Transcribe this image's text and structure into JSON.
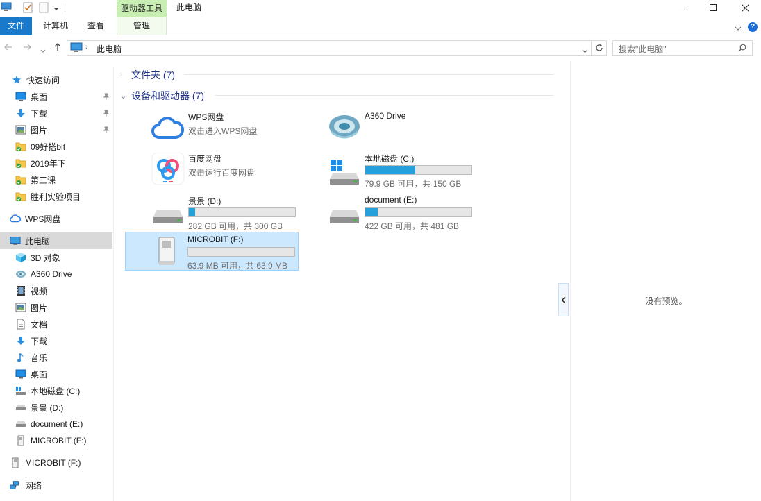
{
  "titlebar": {
    "context_tab_group": "驱动器工具",
    "window_title": "此电脑"
  },
  "ribbon": {
    "tabs": [
      {
        "label": "文件",
        "active": true
      },
      {
        "label": "计算机"
      },
      {
        "label": "查看"
      },
      {
        "label": "管理"
      }
    ],
    "help_label": "?"
  },
  "address": {
    "path_label": "此电脑"
  },
  "search": {
    "placeholder": "搜索\"此电脑\""
  },
  "sidebar": {
    "items": [
      {
        "label": "快速访问",
        "icon": "star-icon"
      },
      {
        "label": "桌面",
        "icon": "desktop-icon",
        "pinned": true
      },
      {
        "label": "下载",
        "icon": "download-icon",
        "pinned": true
      },
      {
        "label": "图片",
        "icon": "pictures-icon",
        "pinned": true
      },
      {
        "label": "09好搭bit",
        "icon": "folder-sync-icon"
      },
      {
        "label": "2019年下",
        "icon": "folder-sync-icon"
      },
      {
        "label": "第三课",
        "icon": "folder-sync-icon"
      },
      {
        "label": "胜利实验项目",
        "icon": "folder-sync-icon"
      },
      {
        "label": "WPS网盘",
        "icon": "cloud-icon"
      },
      {
        "label": "此电脑",
        "icon": "computer-icon",
        "selected": true
      },
      {
        "label": "3D 对象",
        "icon": "3d-objects-icon"
      },
      {
        "label": "A360 Drive",
        "icon": "a360-icon"
      },
      {
        "label": "视频",
        "icon": "video-icon"
      },
      {
        "label": "图片",
        "icon": "pictures-icon"
      },
      {
        "label": "文档",
        "icon": "documents-icon"
      },
      {
        "label": "下载",
        "icon": "download-icon"
      },
      {
        "label": "音乐",
        "icon": "music-icon"
      },
      {
        "label": "桌面",
        "icon": "desktop-icon"
      },
      {
        "label": "本地磁盘 (C:)",
        "icon": "windows-drive-icon"
      },
      {
        "label": "景景 (D:)",
        "icon": "drive-icon"
      },
      {
        "label": "document (E:)",
        "icon": "drive-icon"
      },
      {
        "label": "MICROBIT (F:)",
        "icon": "usb-drive-icon"
      },
      {
        "label": "MICROBIT (F:)",
        "icon": "usb-drive-icon"
      },
      {
        "label": "网络",
        "icon": "network-icon"
      }
    ]
  },
  "groups": {
    "folders": {
      "label": "文件夹 (7)",
      "expanded": false
    },
    "devices": {
      "label": "设备和驱动器 (7)",
      "expanded": true
    }
  },
  "devices": [
    {
      "name": "WPS网盘",
      "subtitle": "双击进入WPS网盘",
      "icon": "wps-cloud-icon"
    },
    {
      "name": "A360 Drive",
      "icon": "a360-drive-icon"
    },
    {
      "name": "百度网盘",
      "subtitle": "双击运行百度网盘",
      "icon": "baidu-netdisk-icon"
    },
    {
      "name": "本地磁盘 (C:)",
      "usage_text": "79.9 GB 可用，共 150 GB",
      "used_fraction": 0.47,
      "icon": "windows-drive-icon"
    },
    {
      "name": "景景 (D:)",
      "usage_text": "282 GB 可用，共 300 GB",
      "used_fraction": 0.06,
      "icon": "hard-drive-icon"
    },
    {
      "name": "document (E:)",
      "usage_text": "422 GB 可用，共 481 GB",
      "used_fraction": 0.12,
      "icon": "hard-drive-icon"
    },
    {
      "name": "MICROBIT (F:)",
      "usage_text": "63.9 MB 可用，共 63.9 MB",
      "used_fraction": 0.0,
      "icon": "usb-drive-icon",
      "selected": true
    }
  ],
  "preview": {
    "text": "没有预览。"
  },
  "colors": {
    "accent": "#1979ca",
    "selection": "#cce8ff",
    "bar_fill": "#26a0da",
    "context_tab": "#c9eeb4"
  }
}
